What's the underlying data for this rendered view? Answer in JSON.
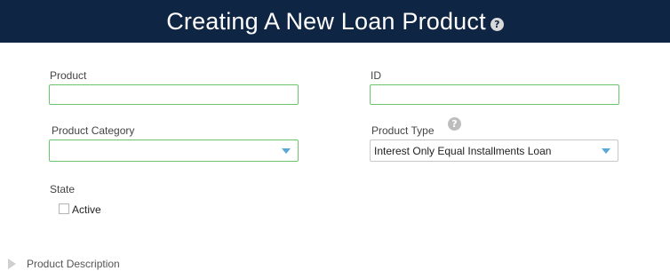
{
  "header": {
    "title": "Creating A New Loan Product",
    "help_glyph": "?"
  },
  "form": {
    "product": {
      "label": "Product",
      "value": ""
    },
    "id": {
      "label": "ID",
      "value": ""
    },
    "product_category": {
      "label": "Product Category",
      "selected": ""
    },
    "product_type": {
      "label": "Product Type",
      "help_glyph": "?",
      "selected": "Interest Only Equal Installments Loan"
    },
    "state": {
      "label": "State",
      "active_label": "Active",
      "active_checked": false
    }
  },
  "sections": {
    "product_description": {
      "label": "Product Description",
      "expanded": false
    }
  },
  "icons": {
    "header_help": "question-circle-icon",
    "product_type_help": "question-circle-icon",
    "select_caret": "caret-down-icon",
    "section_expand": "triangle-right-icon"
  },
  "colors": {
    "header_bg": "#0f2544",
    "valid_border": "#6cc56c",
    "caret": "#5aa8d8"
  }
}
